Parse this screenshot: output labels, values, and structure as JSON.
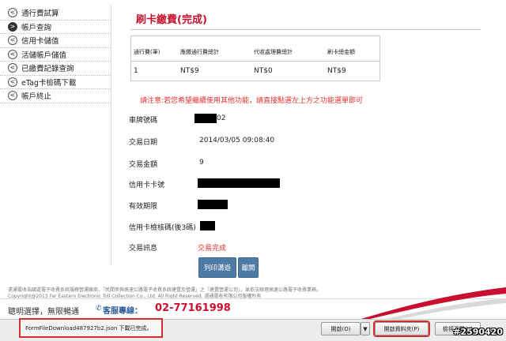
{
  "sidebar": {
    "items": [
      {
        "label": "通行費試算",
        "active": false
      },
      {
        "label": "帳戶查詢",
        "active": true
      },
      {
        "label": "信用卡儲值",
        "active": false
      },
      {
        "label": "活儲帳戶儲值",
        "active": false
      },
      {
        "label": "已繳費記錄查詢",
        "active": false
      },
      {
        "label": "eTag卡檢碼下載",
        "active": false
      },
      {
        "label": "帳戶終止",
        "active": false
      }
    ]
  },
  "page_title": "刷卡繳費(完成)",
  "fee_table": {
    "headers": [
      "通行費(筆)",
      "應繳通行費總計",
      "代收處理費總計",
      "刷卡總金額"
    ],
    "row": [
      "1",
      "NT$9",
      "NT$0",
      "NT$9"
    ]
  },
  "notice": "請注意:若您希望繼續使用其他功能，請直接點選左上方之功能選單即可",
  "fields": {
    "plate_label": "車牌號碼",
    "plate_value_suffix": "02",
    "date_label": "交易日期",
    "date_value": "2014/03/05 09:08:40",
    "amount_label": "交易金額",
    "amount_value": "9",
    "card_label": "信用卡卡號",
    "expiry_label": "有效期限",
    "cvv_label": "信用卡檢核碼(後3碼)",
    "message_label": "交易訊息",
    "message_value": "交易完成"
  },
  "buttons": {
    "print": "列印溝遊",
    "leave": "離開"
  },
  "footer": {
    "line1": "遠通電收為國道電子收費系統服務營運廠商，「民間參與高速公路電子收費系統建置及營運」之「建置營運公司」，並依法辦理高速公路電子收費業務。",
    "line2": "Copyright@2013 Far Eastern Electronic Toll Collection Co., Ltd. All Right Reserved. 遠通電收有限公司版權所有",
    "slogan": "聰明選擇，無限暢通",
    "hotline_label": "客服專線：",
    "hotline_number": "02-77161998"
  },
  "download_bar": {
    "file_text": "FormFileDownload487927b2.json 下載已完成。",
    "open_label": "開啟(O)",
    "dropdown_icon": "chevron-down-icon",
    "open_folder_label": "開啟資料夾(P)",
    "view_downloads_label": "檢視下載(V)"
  },
  "watermark": "#2590420",
  "colors": {
    "title_red": "#c8102e",
    "notice_red": "#e03030",
    "button_blue": "#4d7ba3",
    "highlight_red": "#d32f2f",
    "hotline_blue": "#2b5a9a"
  }
}
